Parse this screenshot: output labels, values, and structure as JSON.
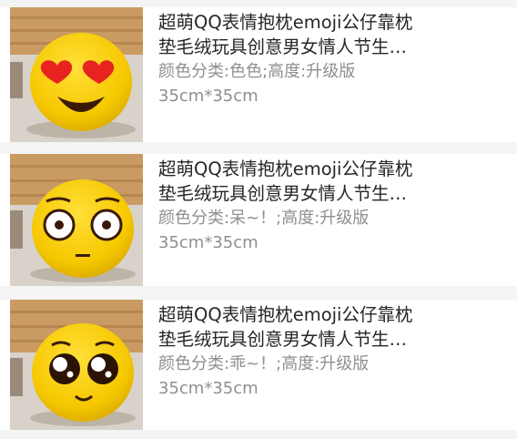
{
  "items": [
    {
      "title_line1": "超萌QQ表情抱枕emoji公仔靠枕",
      "title_line2": "垫毛绒玩具创意男女情人节生…",
      "sku_line1": "颜色分类:色色;高度:升级版",
      "sku_line2": "35cm*35cm",
      "face": "heart-eyes-emoji-pillow"
    },
    {
      "title_line1": "超萌QQ表情抱枕emoji公仔靠枕",
      "title_line2": "垫毛绒玩具创意男女情人节生…",
      "sku_line1": "颜色分类:呆~！;高度:升级版",
      "sku_line2": "35cm*35cm",
      "face": "dazed-emoji-pillow"
    },
    {
      "title_line1": "超萌QQ表情抱枕emoji公仔靠枕",
      "title_line2": "垫毛绒玩具创意男女情人节生…",
      "sku_line1": "颜色分类:乖~！;高度:升级版",
      "sku_line2": "35cm*35cm",
      "face": "cute-teary-eyes-emoji-pillow"
    }
  ],
  "colors": {
    "emoji_yellow": "#f6c800",
    "heart_red": "#e8231f",
    "title_text": "#262626",
    "sku_text": "#8f8f8f"
  }
}
